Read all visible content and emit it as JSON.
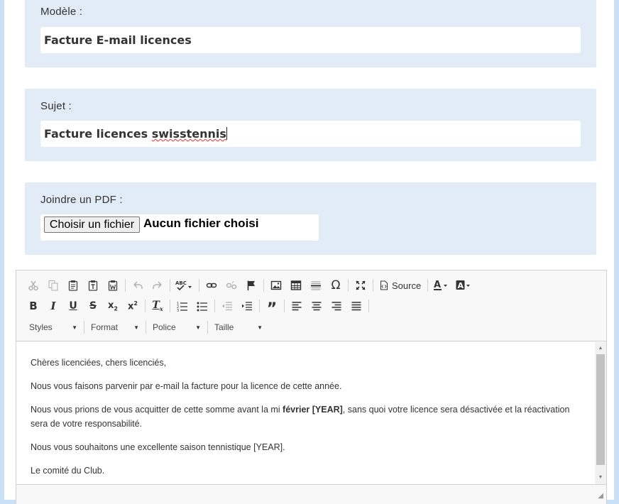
{
  "modele": {
    "label": "Modèle :",
    "value": "Facture E-mail licences"
  },
  "sujet": {
    "label": "Sujet :",
    "value_prefix": "Facture licences ",
    "value_misspelled": "swisstennis"
  },
  "pdf": {
    "label": "Joindre un PDF :",
    "button": "Choisir un fichier",
    "status": "Aucun fichier choisi"
  },
  "toolbar": {
    "source_label": "Source",
    "combos": {
      "styles": "Styles",
      "format": "Format",
      "police": "Police",
      "taille": "Taille"
    }
  },
  "content": {
    "p1": "Chères licenciées, chers licenciés,",
    "p2": "Nous vous faisons parvenir par e-mail la facture pour la licence de cette année.",
    "p3_a": "Nous vous prions de vous acquitter de cette somme avant la mi  ",
    "p3_bold": "février [YEAR]",
    "p3_b": ", sans quoi votre licence sera désactivée et la réactivation sera de votre responsabilité.",
    "p4": "Nous vous souhaitons une excellente saison tennistique [YEAR].",
    "p5": "Le comité du Club."
  },
  "colors": {
    "panel": "#e2ecf7",
    "page_bg": "#c9e0f7"
  }
}
